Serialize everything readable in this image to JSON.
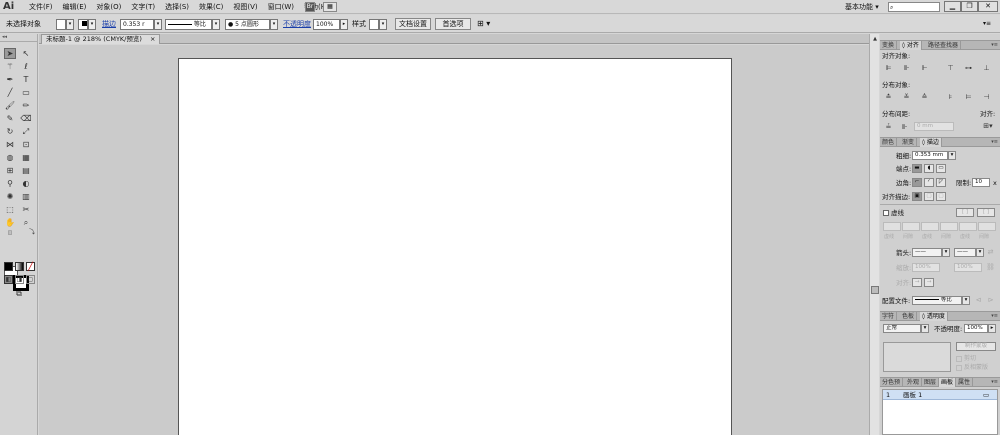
{
  "app": {
    "logo": "Ai"
  },
  "menu": {
    "items": [
      "文件(F)",
      "编辑(E)",
      "对象(O)",
      "文字(T)",
      "选择(S)",
      "效果(C)",
      "视图(V)",
      "窗口(W)",
      "帮助(H)"
    ],
    "br_label": "Br"
  },
  "workspace": {
    "label": "基本功能 ▾"
  },
  "window_controls": {
    "minimize": "▁",
    "restore": "❐",
    "close": "✕"
  },
  "control_bar": {
    "selection_status": "未选择对象",
    "stroke_label": "描边",
    "stroke_weight": "0.353 r",
    "stroke_style": "等比",
    "brush": "● 5 点圆形",
    "opacity_label": "不透明度",
    "opacity_value": "100%",
    "style_label": "样式",
    "doc_setup_button": "文档设置",
    "preferences_button": "首选项"
  },
  "document": {
    "tab_title": "未标题-1 @ 218% (CMYK/预览)",
    "tab_close": "×"
  },
  "align_panel": {
    "tabs": [
      "变换",
      "◊ 对齐",
      "路径查找器"
    ],
    "align_objects_label": "对齐对象:",
    "distribute_objects_label": "分布对象:",
    "distribute_spacing_label": "分布间距:",
    "spacing_value": "0 mm",
    "align_to_label": "对齐:"
  },
  "stroke_panel": {
    "tabs": [
      "颜色",
      "渐变",
      "◊ 描边"
    ],
    "weight_label": "粗细:",
    "weight_value": "0.353 mm",
    "cap_label": "端点:",
    "corner_label": "边角:",
    "limit_label": "限制:",
    "limit_value": "10",
    "limit_unit": "x",
    "align_stroke_label": "对齐描边:",
    "dashed_label": "虚线",
    "dash_labels": [
      "虚线",
      "间隙",
      "虚线",
      "间隙",
      "虚线",
      "间隙"
    ],
    "arrowheads_label": "箭头:",
    "scale_label": "缩放:",
    "scale_values": [
      "100%",
      "100%"
    ],
    "align_label": "对齐:",
    "profile_label": "配置文件:",
    "profile_value": "等比"
  },
  "transparency_panel": {
    "tabs": [
      "字符",
      "色板",
      "◊ 透明度"
    ],
    "blend_mode": "正常",
    "opacity_label": "不透明度:",
    "opacity_value": "100%",
    "make_mask_button": "制作蒙版",
    "clip_label": "剪切",
    "invert_label": "反相蒙版"
  },
  "artboards_panel": {
    "tabs": [
      "分色预",
      "外观",
      "图层",
      "画板",
      "属性"
    ],
    "rows": [
      {
        "index": "1",
        "name": "画板 1"
      }
    ]
  },
  "colors": {
    "accent_link": "#1b3faa",
    "selected_row": "#cfe0f4"
  }
}
